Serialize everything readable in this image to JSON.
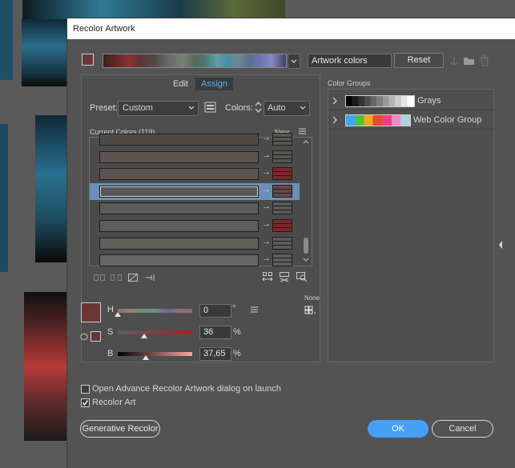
{
  "window": {
    "title": "Recolor Artwork"
  },
  "top": {
    "artwork_colors_value": "Artwork colors",
    "reset_label": "Reset"
  },
  "tabs": {
    "edit": "Edit",
    "assign": "Assign"
  },
  "preset": {
    "label": "Preset:",
    "value": "Custom"
  },
  "colors": {
    "label": "Colors:",
    "value": "Auto"
  },
  "current_colors": {
    "label": "Current Colors (119)",
    "new_label": "New",
    "rows": [
      {
        "current": "#4f4a46",
        "new": "#5a5550",
        "selected": false
      },
      {
        "current": "#5c5450",
        "new": "#5a5550",
        "selected": false
      },
      {
        "current": "#5e5350",
        "new": "#7a2828",
        "selected": false
      },
      {
        "current": "#575655",
        "new": "#6a4848",
        "selected": true
      },
      {
        "current": "#5c5d5a",
        "new": "#5a5a58",
        "selected": false
      },
      {
        "current": "#5d5e59",
        "new": "#7a2828",
        "selected": false
      },
      {
        "current": "#5f615b",
        "new": "#5a5a58",
        "selected": false
      },
      {
        "current": "#646761",
        "new": "#5e5e5c",
        "selected": false
      }
    ]
  },
  "hsb": {
    "h_label": "H",
    "h_value": "0",
    "h_unit": "°",
    "h_level": 0,
    "s_label": "S",
    "s_value": "36",
    "s_unit": "%",
    "s_level": 36,
    "b_label": "B",
    "b_value": "37,65",
    "b_unit": "%",
    "b_level": 37.65,
    "none_label": "None",
    "current_color": "#6a3636"
  },
  "color_groups": {
    "label": "Color Groups",
    "groups": [
      {
        "name": "Grays"
      },
      {
        "name": "Web Color Group"
      }
    ]
  },
  "options": {
    "advance_dialog_label": "Open Advance Recolor Artwork dialog on launch",
    "advance_dialog_checked": false,
    "recolor_art_label": "Recolor Art",
    "recolor_art_checked": true
  },
  "buttons": {
    "generative": "Generative Recolor",
    "ok": "OK",
    "cancel": "Cancel"
  },
  "colors_theme": {
    "accent": "#46a0f5",
    "selected_row": "#6a8fb8"
  }
}
